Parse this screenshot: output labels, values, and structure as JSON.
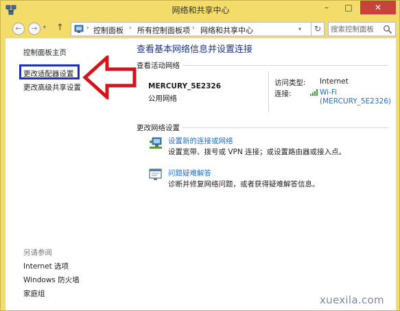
{
  "window": {
    "title": "网络和共享中心",
    "controls": {
      "minimize": "–",
      "maximize": "□",
      "close": "✕"
    }
  },
  "addressbar": {
    "back_glyph": "←",
    "forward_glyph": "→",
    "up_glyph": "↑",
    "dropdown_glyph": "▾",
    "refresh_glyph": "↻",
    "separator": "›",
    "breadcrumbs": [
      "控制面板",
      "所有控制面板项",
      "网络和共享中心"
    ],
    "search_placeholder": "搜索控制面板"
  },
  "left_pane": {
    "home": "控制面板主页",
    "change_adapter": "更改适配器设置",
    "change_advanced_sharing": "更改高级共享设置",
    "see_also_title": "另请参阅",
    "see_also": [
      "Internet 选项",
      "Windows 防火墙",
      "家庭组"
    ]
  },
  "main": {
    "title": "查看基本网络信息并设置连接",
    "active_networks_heading": "查看活动网络",
    "network": {
      "name": "MERCURY_5E2326",
      "type": "公用网络",
      "access_type_label": "访问类型:",
      "access_type_value": "Internet",
      "connection_label": "连接:",
      "connection_value": "Wi-Fi",
      "connection_ssid": "(MERCURY_5E2326)"
    },
    "change_settings_heading": "更改网络设置",
    "tasks": [
      {
        "link": "设置新的连接或网络",
        "description": "设置宽带、拨号或 VPN 连接；或设置路由器或接入点。"
      },
      {
        "link": "问题疑难解答",
        "description": "诊断并修复网络问题，或者获得疑难解答信息。"
      }
    ]
  },
  "watermark": "xuexila.com",
  "colors": {
    "frame": "#f3dc6a",
    "title_link": "#1e3287",
    "link": "#1f6fc5",
    "highlight_box": "#1c2fb8",
    "annotation_arrow": "#d4131b",
    "close_button": "#c7423a"
  }
}
